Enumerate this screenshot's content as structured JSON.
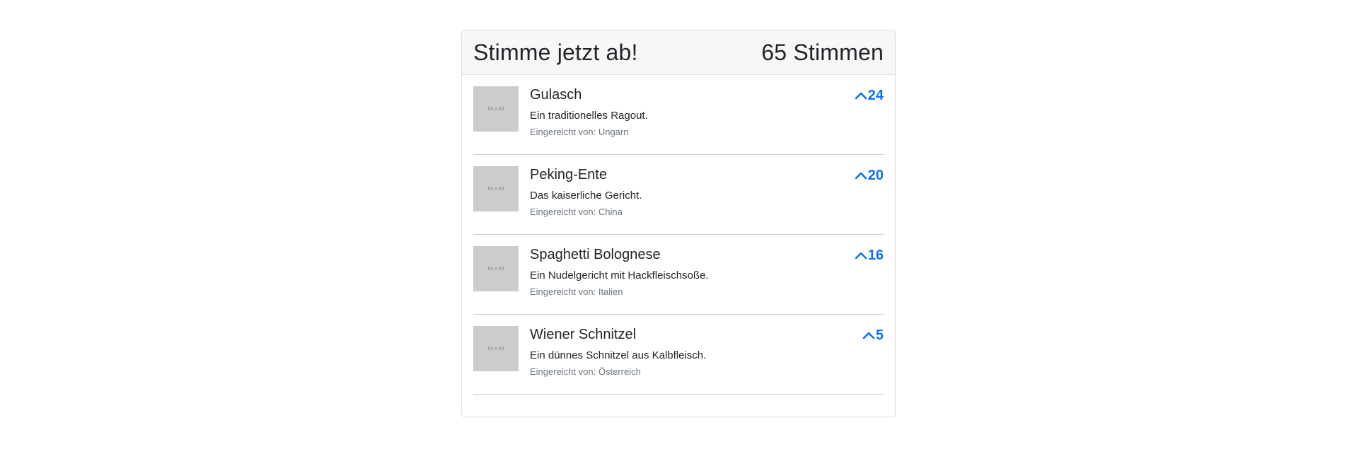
{
  "header": {
    "title": "Stimme jetzt ab!",
    "total_votes": "65 Stimmen"
  },
  "items": [
    {
      "placeholder": "64 x 64",
      "title": "Gulasch",
      "description": "Ein traditionelles Ragout.",
      "submitted": "Eingereicht von: Ungarn",
      "votes": "24"
    },
    {
      "placeholder": "64 x 64",
      "title": "Peking-Ente",
      "description": "Das kaiserliche Gericht.",
      "submitted": "Eingereicht von: China",
      "votes": "20"
    },
    {
      "placeholder": "64 x 64",
      "title": "Spaghetti Bolognese",
      "description": "Ein Nudelgericht mit Hackfleischsoße.",
      "submitted": "Eingereicht von: Italien",
      "votes": "16"
    },
    {
      "placeholder": "64 x 64",
      "title": "Wiener Schnitzel",
      "description": "Ein dünnes Schnitzel aus Kalbfleisch.",
      "submitted": "Eingereicht von: Österreich",
      "votes": "5"
    }
  ],
  "icons": {
    "vote": "chevron-up-icon"
  },
  "colors": {
    "accent": "#0d6efd",
    "header_bg": "#f7f7f7",
    "thumb_bg": "#cccccc"
  }
}
